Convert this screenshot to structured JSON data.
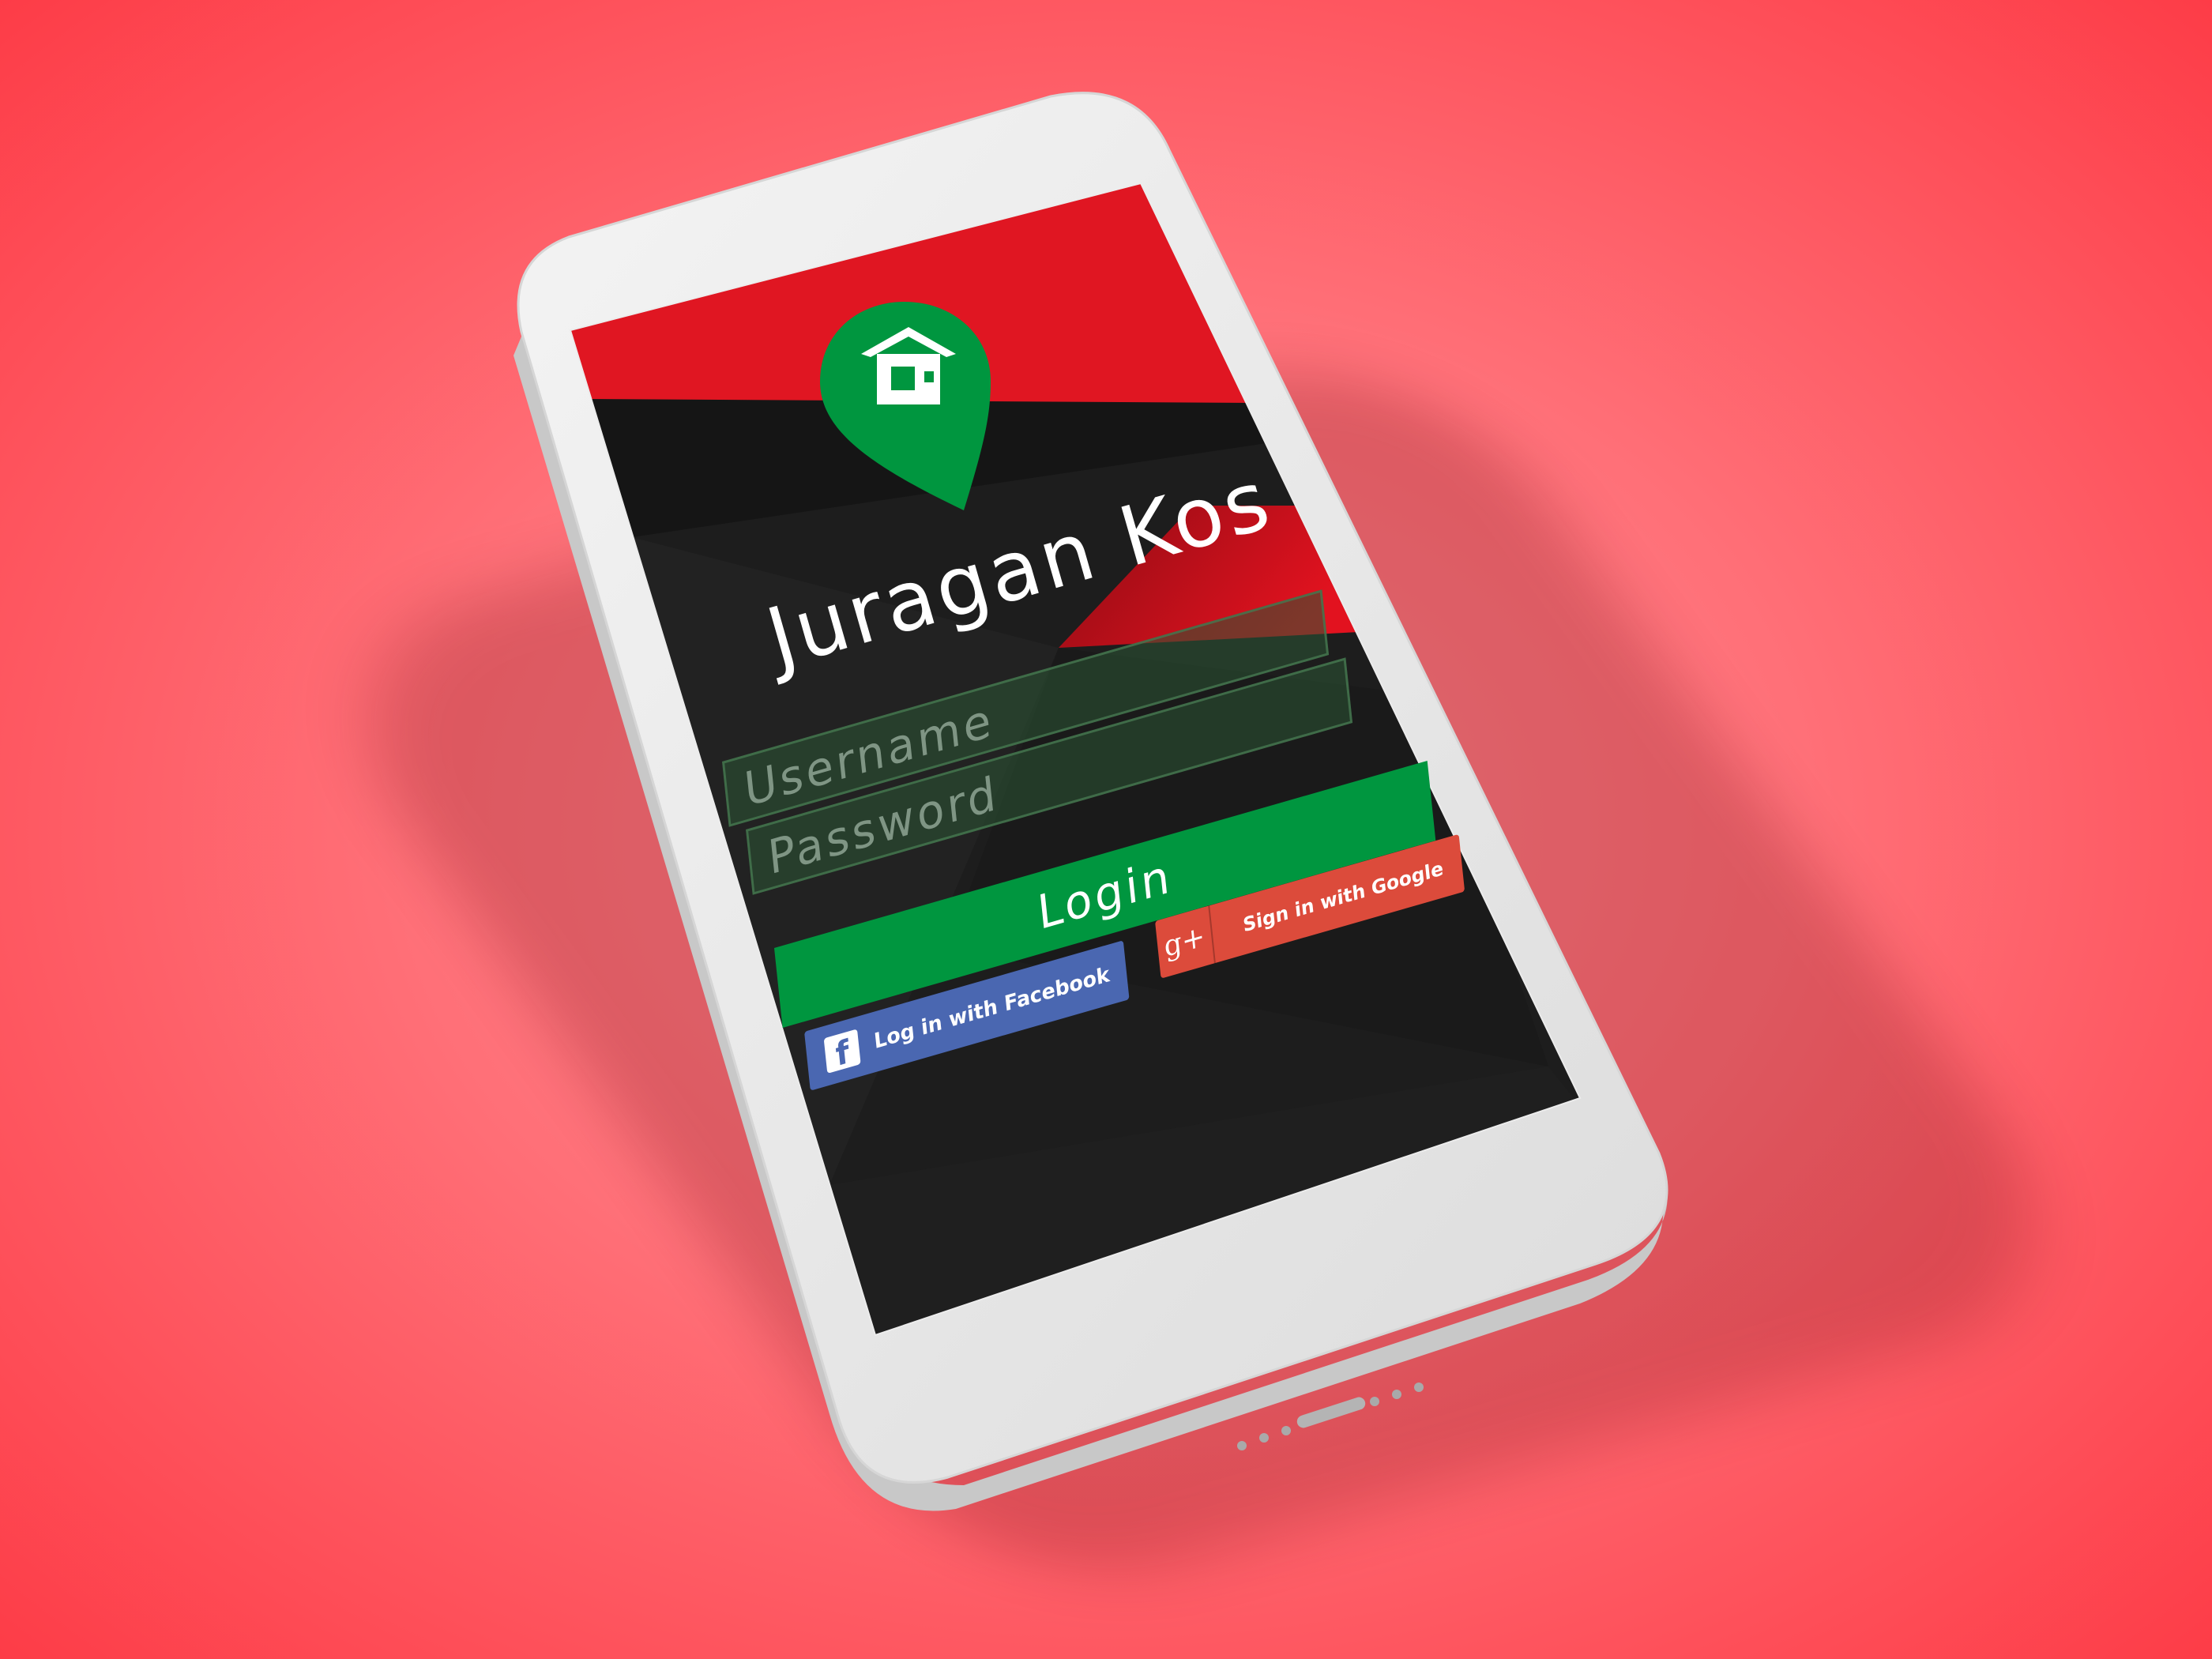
{
  "app": {
    "title": "Juragan Kos"
  },
  "login_form": {
    "username_placeholder": "Username",
    "password_placeholder": "Password",
    "login_label": "Login"
  },
  "social": {
    "facebook_label": "Log in with Facebook",
    "facebook_icon": "facebook-icon",
    "google_label": "Sign in with Google",
    "google_icon_text": "g+"
  },
  "colors": {
    "background": "#ff6b74",
    "screen_red": "#e01622",
    "screen_dark": "#1c1c1c",
    "brand_green": "#00963f",
    "facebook_blue": "#4a67b1",
    "google_red": "#dc4b3b"
  }
}
